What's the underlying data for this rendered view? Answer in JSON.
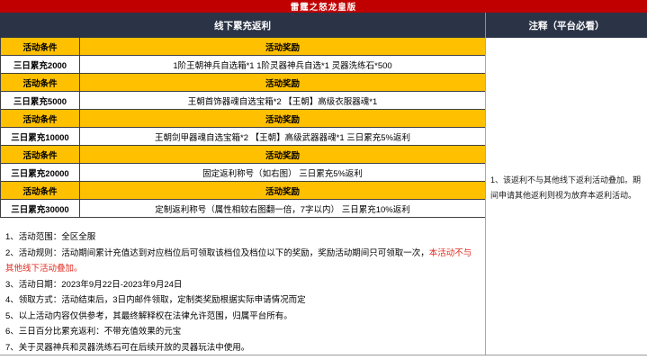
{
  "title": "雷霆之怒龙皇版",
  "headers": {
    "left": "线下累充返利",
    "right": "注释（平台必看）"
  },
  "table": {
    "condition_header": "活动条件",
    "reward_header": "活动奖励",
    "rows": [
      {
        "condition": "三日累充2000",
        "reward": "1阶王朝神兵自选箱*1 1阶灵器神兵自选*1 灵器洗练石*500"
      },
      {
        "condition": "三日累充5000",
        "reward": "王朝首饰器魂自选宝箱*2 【王朝】高级衣服器魂*1"
      },
      {
        "condition": "三日累充10000",
        "reward": "王朝剑甲器魂自选宝箱*2 【王朝】高级武器器魂*1 三日累充5%返利"
      },
      {
        "condition": "三日累充20000",
        "reward": "固定返利称号（如右图） 三日累充5%返利"
      },
      {
        "condition": "三日累充30000",
        "reward": "定制返利称号（属性相较右图翻一倍，7字以内） 三日累充10%返利"
      }
    ]
  },
  "notes": [
    {
      "text": "1、活动范围：全区全服"
    },
    {
      "text": "2、活动规则：活动期间累计充值达到对应档位后可领取该档位及档位以下的奖励，奖励活动期间只可领取一次，",
      "red_text": "本活动不与其他线下活动叠加。"
    },
    {
      "text": "3、活动日期：2023年9月22日-2023年9月24日"
    },
    {
      "text": "4、领取方式：活动结束后，3日内邮件领取，定制类奖励根据实际申请情况而定"
    },
    {
      "text": "5、以上活动内容仅供参考，其最终解释权在法律允许范围，归属平台所有。"
    },
    {
      "text": "6、三日百分比累充返利：不带充值效果的元宝"
    },
    {
      "text": "7、关于灵器神兵和灵器洗练石可在后续开放的灵器玩法中使用。"
    }
  ],
  "annotation": "1、该返利不与其他线下返利活动叠加。期间申请其他返利则视为放弃本返利活动。",
  "colors": {
    "title_bg": "#c00000",
    "section_header_bg": "#2b3447",
    "row_header_bg": "#ffc000",
    "warning_red": "#e02b20"
  }
}
